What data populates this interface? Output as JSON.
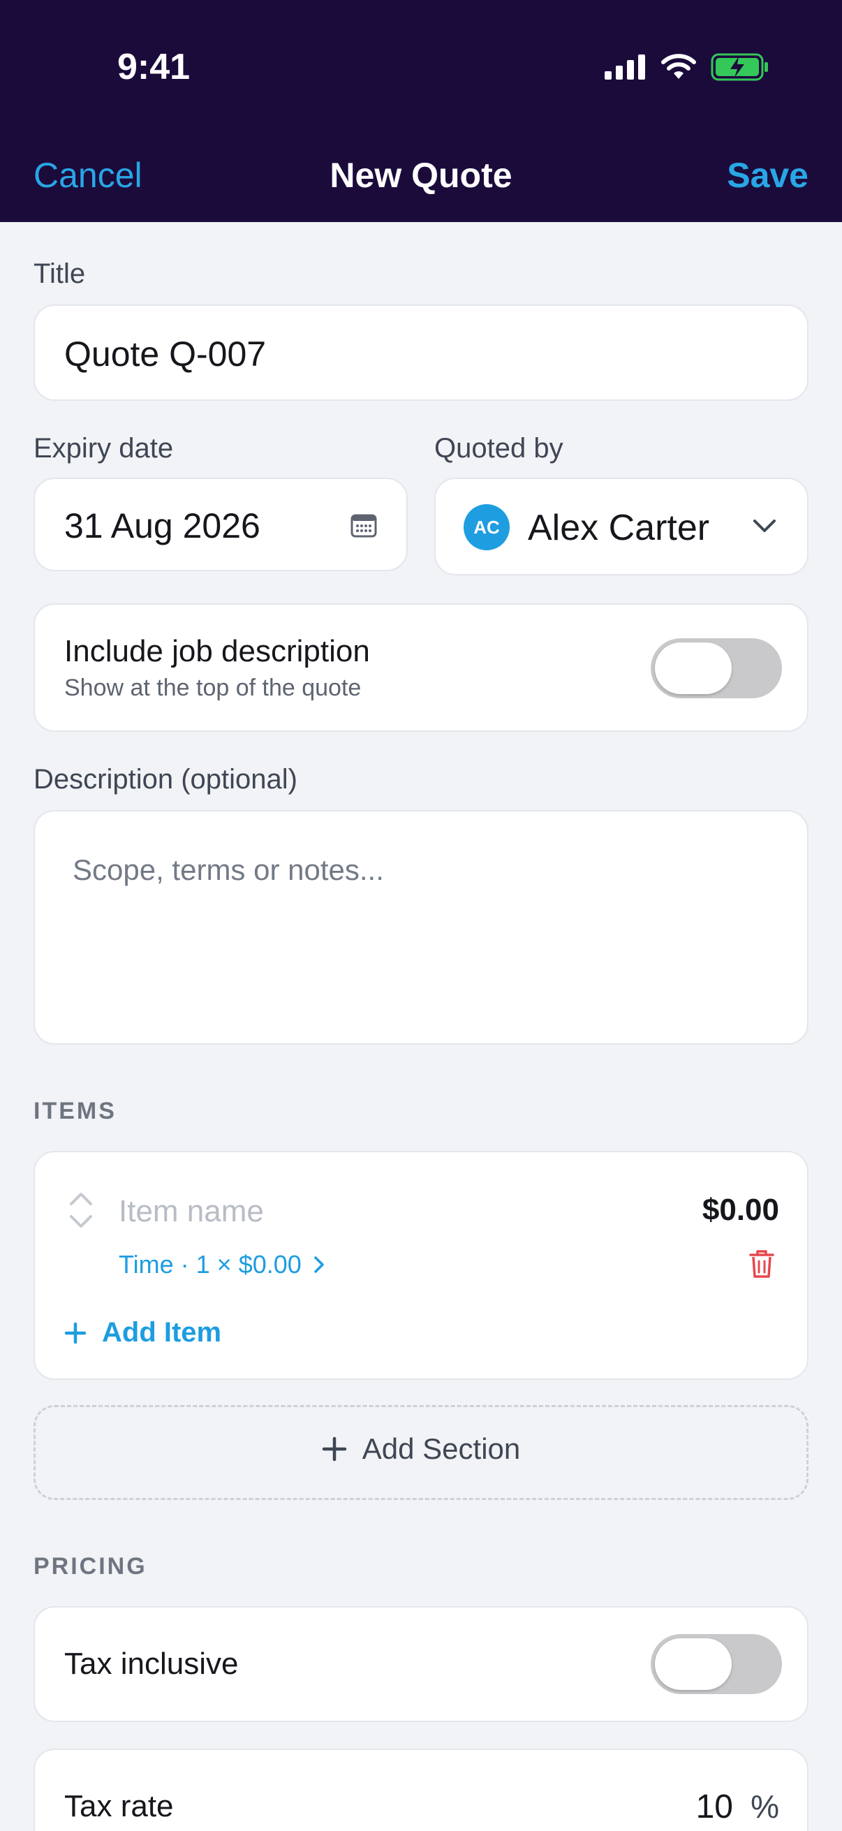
{
  "status": {
    "time": "9:41"
  },
  "nav": {
    "cancel": "Cancel",
    "title": "New Quote",
    "save": "Save"
  },
  "form": {
    "title_label": "Title",
    "title_value": "Quote Q-007",
    "expiry_label": "Expiry date",
    "expiry_value": "31 Aug 2026",
    "quoted_by_label": "Quoted by",
    "quoted_by_initials": "AC",
    "quoted_by_name": "Alex Carter",
    "include_desc_title": "Include job description",
    "include_desc_subtitle": "Show at the top of the quote",
    "description_label": "Description (optional)",
    "description_placeholder": "Scope, terms or notes..."
  },
  "items": {
    "section_label": "ITEMS",
    "item_name_placeholder": "Item name",
    "item_price": "$0.00",
    "item_meta": "Time · 1 × $0.00",
    "add_item": "Add Item",
    "add_section": "Add Section"
  },
  "pricing": {
    "section_label": "PRICING",
    "tax_inclusive_label": "Tax inclusive",
    "tax_rate_label": "Tax rate",
    "tax_rate_value": "10",
    "tax_rate_unit": "%"
  },
  "colors": {
    "header_bg": "#1b0b3b",
    "accent": "#29a6e6",
    "danger": "#e5484d",
    "toggle_off": "#c9c9cc"
  },
  "toggles": {
    "include_job_description": false,
    "tax_inclusive": false
  }
}
